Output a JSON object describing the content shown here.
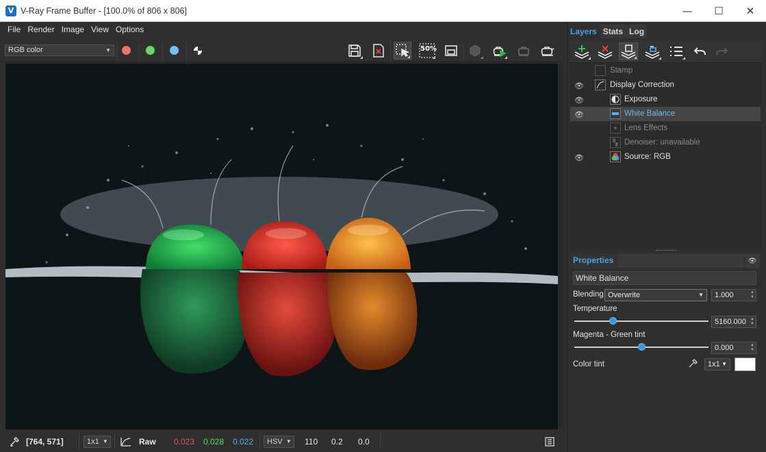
{
  "window": {
    "title": "V-Ray Frame Buffer - [100.0% of 806 x 806]",
    "logo_letter": "V",
    "minimize_glyph": "—",
    "maximize_glyph": "☐",
    "close_glyph": "✕"
  },
  "menu": [
    "File",
    "Render",
    "Image",
    "View",
    "Options"
  ],
  "toolbar": {
    "channel": "RGB color",
    "colors": {
      "red": "#f07070",
      "green": "#6ad46a",
      "blue": "#6cc2f2"
    },
    "buttons": [
      "save-icon",
      "clear-image-icon",
      "region-render-icon",
      "test-resolution-icon",
      "track-mouse-icon",
      "render-last-icon",
      "render-interactive-icon",
      "stop-render-icon",
      "render-icon"
    ],
    "test_resolution_label": "50%"
  },
  "status": {
    "coords": "[764, 571]",
    "zoom": "1x1",
    "mode": "Raw",
    "r": "0.023",
    "g": "0.028",
    "b": "0.022",
    "color_space": "HSV",
    "h": "110",
    "s": "0.2",
    "v": "0.0",
    "r_color": "#f05050",
    "g_color": "#5adc5a",
    "b_color": "#5aaef0"
  },
  "panel": {
    "tabs": [
      "Layers",
      "Stats",
      "Log"
    ],
    "layers": [
      {
        "name": "Stamp",
        "visible": false,
        "disabled": true
      },
      {
        "name": "Display Correction",
        "visible": true,
        "disabled": false
      },
      {
        "name": "Exposure",
        "visible": true,
        "disabled": false
      },
      {
        "name": "White Balance",
        "visible": true,
        "disabled": false,
        "selected": true
      },
      {
        "name": "Lens Effects",
        "visible": false,
        "disabled": true
      },
      {
        "name": "Denoiser: unavailable",
        "visible": false,
        "disabled": true
      },
      {
        "name": "Source: RGB",
        "visible": true,
        "disabled": false
      }
    ],
    "properties": {
      "title": "Properties",
      "layer_name": "White Balance",
      "blending_label": "Blending",
      "blending_mode": "Overwrite",
      "blending_value": "1.000",
      "temperature_label": "Temperature",
      "temperature_value": "5160.000",
      "temperature_fraction": 0.29,
      "tint_label": "Magenta - Green tint",
      "tint_value": "0.000",
      "tint_fraction": 0.5,
      "color_tint_label": "Color tint",
      "color_tint_size": "1x1",
      "color_tint_color": "#ffffff"
    }
  }
}
